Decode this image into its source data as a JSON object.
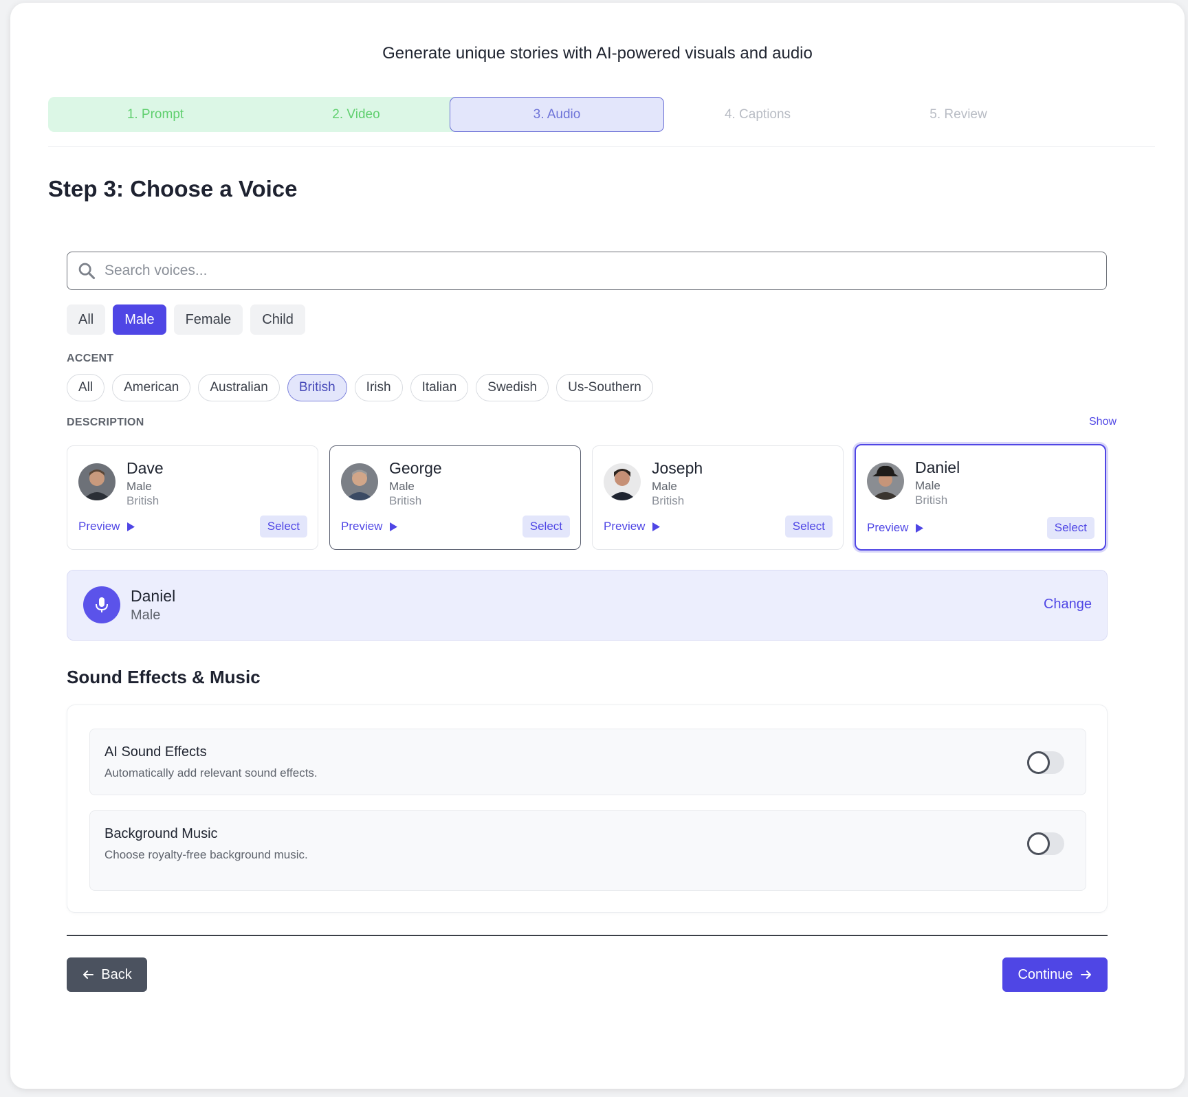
{
  "header": {
    "tagline": "Generate unique stories with AI-powered visuals and audio"
  },
  "steps": [
    {
      "label": "1. Prompt",
      "state": "done"
    },
    {
      "label": "2. Video",
      "state": "done"
    },
    {
      "label": "3. Audio",
      "state": "active"
    },
    {
      "label": "4. Captions",
      "state": "todo"
    },
    {
      "label": "5. Review",
      "state": "todo"
    }
  ],
  "page_title": "Step 3: Choose a Voice",
  "search": {
    "placeholder": "Search voices...",
    "value": ""
  },
  "gender_filters": {
    "options": [
      "All",
      "Male",
      "Female",
      "Child"
    ],
    "selected": "Male"
  },
  "accent": {
    "label": "ACCENT",
    "options": [
      "All",
      "American",
      "Australian",
      "British",
      "Irish",
      "Italian",
      "Swedish",
      "Us-Southern"
    ],
    "selected": "British"
  },
  "description": {
    "label": "DESCRIPTION",
    "toggle_label": "Show"
  },
  "voices": [
    {
      "name": "Dave",
      "gender": "Male",
      "accent": "British",
      "preview_label": "Preview",
      "select_label": "Select"
    },
    {
      "name": "George",
      "gender": "Male",
      "accent": "British",
      "preview_label": "Preview",
      "select_label": "Select"
    },
    {
      "name": "Joseph",
      "gender": "Male",
      "accent": "British",
      "preview_label": "Preview",
      "select_label": "Select"
    },
    {
      "name": "Daniel",
      "gender": "Male",
      "accent": "British",
      "preview_label": "Preview",
      "select_label": "Select"
    }
  ],
  "selected_voice": {
    "name": "Daniel",
    "gender": "Male",
    "change_label": "Change"
  },
  "sound": {
    "title": "Sound Effects & Music",
    "options": [
      {
        "title": "AI Sound Effects",
        "description": "Automatically add relevant sound effects.",
        "enabled": false
      },
      {
        "title": "Background Music",
        "description": "Choose royalty-free background music.",
        "enabled": false
      }
    ]
  },
  "nav": {
    "back_label": "Back",
    "continue_label": "Continue"
  },
  "colors": {
    "accent": "#4f46e5",
    "done_bg": "#dcf7e6",
    "done_text": "#5fcf6e",
    "active_bg": "#e3e6fb"
  }
}
